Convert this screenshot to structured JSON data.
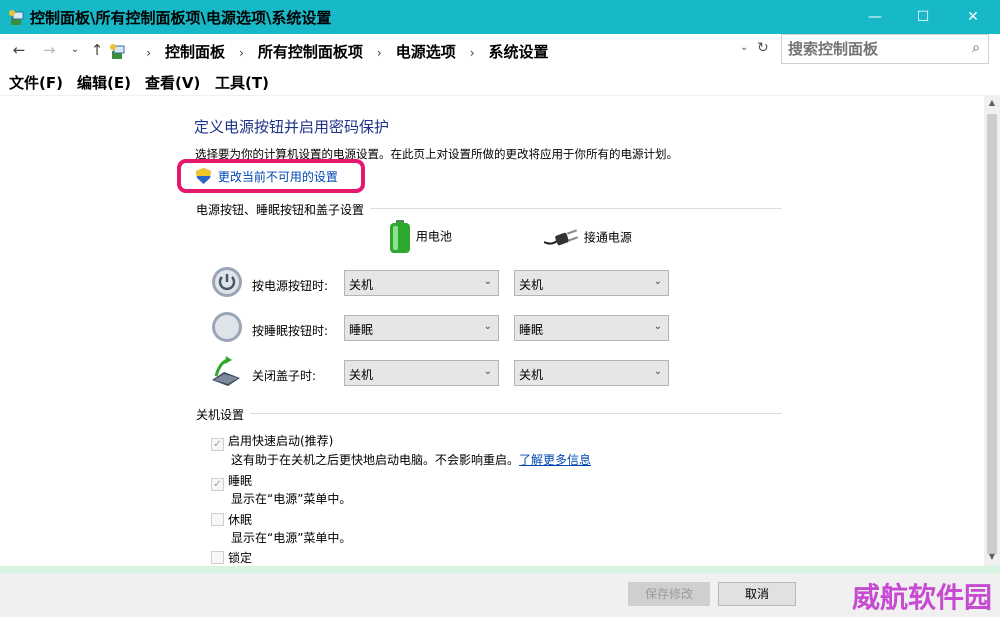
{
  "window": {
    "title": "控制面板\\所有控制面板项\\电源选项\\系统设置",
    "minimize": "—",
    "maximize": "☐",
    "close": "✕"
  },
  "nav": {
    "back": "←",
    "forward": "→",
    "recent": "⌄",
    "up": "↑",
    "dropdown": "⌄",
    "refresh": "↻"
  },
  "breadcrumb": {
    "sep": "›",
    "items": [
      "控制面板",
      "所有控制面板项",
      "电源选项",
      "系统设置"
    ]
  },
  "search": {
    "placeholder": "搜索控制面板",
    "icon": "search-icon"
  },
  "menu": [
    "文件(F)",
    "编辑(E)",
    "查看(V)",
    "工具(T)"
  ],
  "page": {
    "title": "定义电源按钮并启用密码保护",
    "description": "选择要为你的计算机设置的电源设置。在此页上对设置所做的更改将应用于你所有的电源计划。",
    "change_link": "更改当前不可用的设置"
  },
  "buttons_section": {
    "heading": "电源按钮、睡眠按钮和盖子设置",
    "col_battery": "用电池",
    "col_plugged": "接通电源",
    "rows": [
      {
        "label": "按电源按钮时:",
        "battery": "关机",
        "plugged": "关机",
        "icon": "power-icon"
      },
      {
        "label": "按睡眠按钮时:",
        "battery": "睡眠",
        "plugged": "睡眠",
        "icon": "sleep-icon"
      },
      {
        "label": "关闭盖子时:",
        "battery": "关机",
        "plugged": "关机",
        "icon": "laptop-lid-icon"
      }
    ]
  },
  "shutdown_section": {
    "heading": "关机设置",
    "items": [
      {
        "label": "启用快速启动(推荐)",
        "checked": true,
        "desc": "这有助于在关机之后更快地启动电脑。不会影响重启。",
        "link": "了解更多信息"
      },
      {
        "label": "睡眠",
        "checked": true,
        "desc": "显示在“电源”菜单中。"
      },
      {
        "label": "休眠",
        "checked": false,
        "desc": "显示在“电源”菜单中。"
      },
      {
        "label": "锁定",
        "checked": false
      }
    ],
    "check_mark": "✓"
  },
  "footer": {
    "save": "保存修改",
    "cancel": "取消"
  },
  "watermark": "威航软件园",
  "colors": {
    "titlebar": "#17b8c8",
    "link": "#0047b3",
    "highlight": "#e6176d",
    "heading": "#1e3287"
  }
}
